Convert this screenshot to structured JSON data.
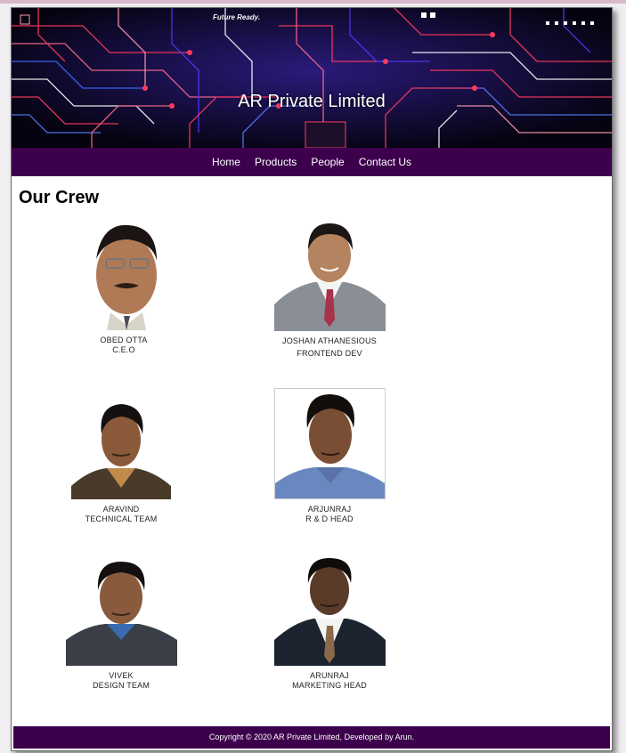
{
  "banner": {
    "tagline": "Future Ready.",
    "brand": "AR Private Limited"
  },
  "nav": {
    "items": [
      {
        "label": "Home"
      },
      {
        "label": "Products"
      },
      {
        "label": "People"
      },
      {
        "label": "Contact Us"
      }
    ]
  },
  "main": {
    "heading": "Our Crew",
    "members": [
      {
        "name": "OBED OTTA",
        "role": "C.E.O"
      },
      {
        "name": "JOSHAN ATHANESIOUS",
        "role": "FRONTEND DEV"
      },
      {
        "name": "ARAVIND",
        "role": "TECHNICAL TEAM"
      },
      {
        "name": "ARJUNRAJ",
        "role": "R & D HEAD"
      },
      {
        "name": "VIVEK",
        "role": "DESIGN TEAM"
      },
      {
        "name": "ARUNRAJ",
        "role": "MARKETING HEAD"
      }
    ]
  },
  "footer": {
    "text": "Copyright © 2020 AR Private Limited, Developed by Arun."
  },
  "colors": {
    "nav_bg": "#3c004c",
    "banner_bg": "#07051a",
    "circuit_red": "#ff3a5e",
    "circuit_blue": "#4b3bff"
  }
}
